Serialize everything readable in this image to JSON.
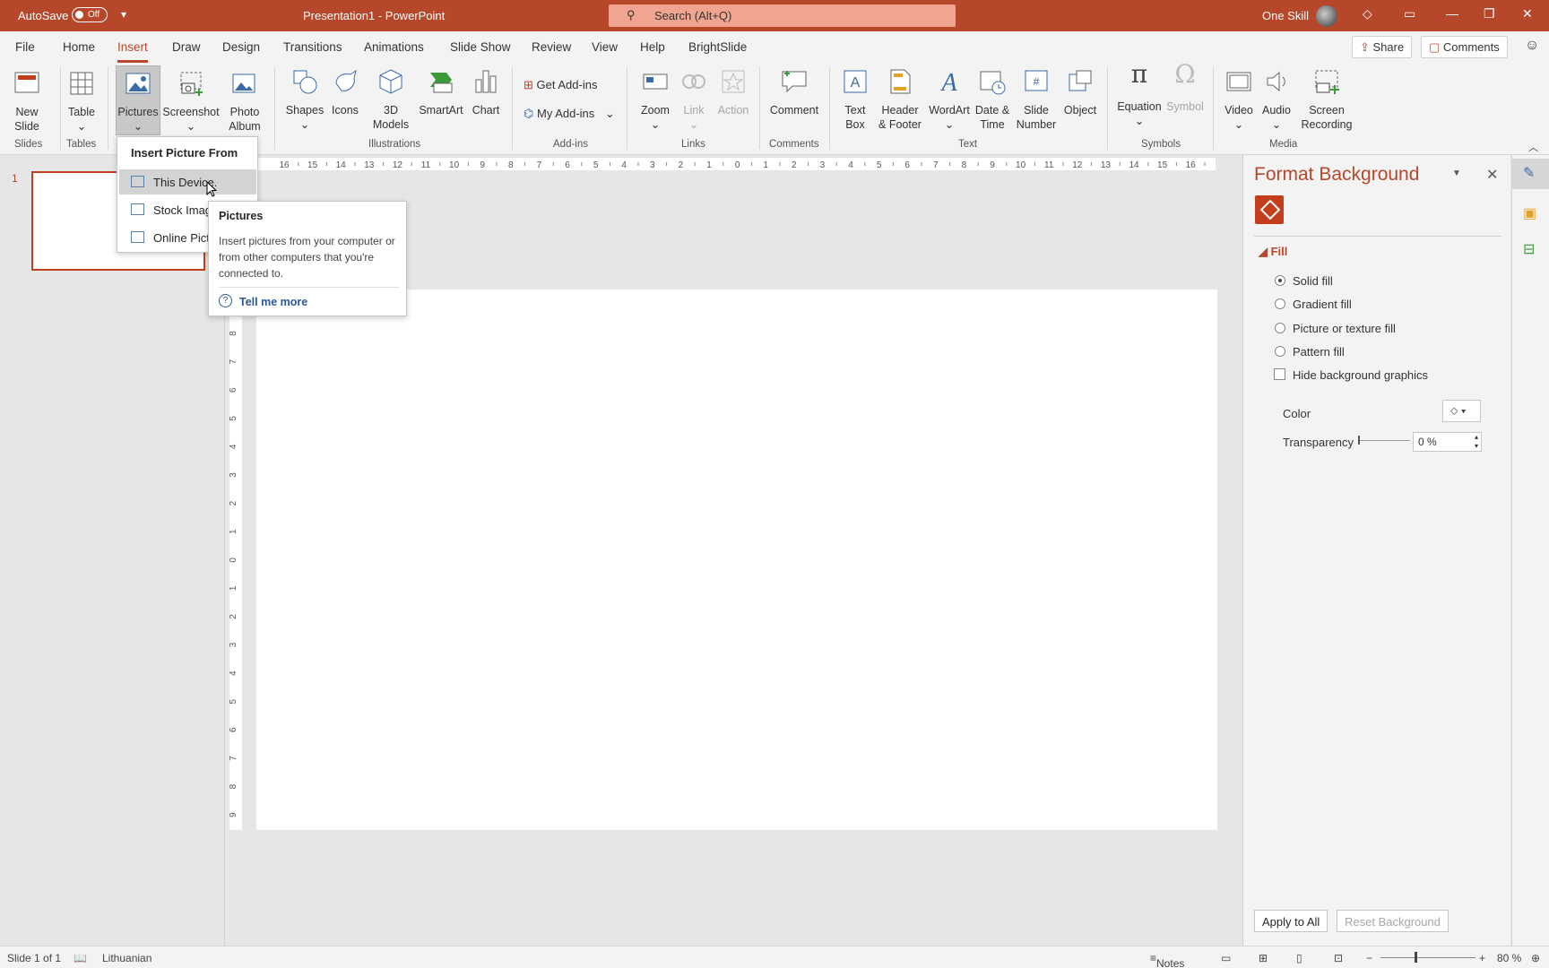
{
  "titlebar": {
    "autosave_label": "AutoSave",
    "autosave_state": "Off",
    "title": "Presentation1  -  PowerPoint",
    "search_placeholder": "Search (Alt+Q)",
    "user_name": "One Skill"
  },
  "tabs": [
    "File",
    "Home",
    "Insert",
    "Draw",
    "Design",
    "Transitions",
    "Animations",
    "Slide Show",
    "Review",
    "View",
    "Help",
    "BrightSlide"
  ],
  "active_tab": "Insert",
  "share_label": "Share",
  "comments_label": "Comments",
  "ribbon": {
    "slides": {
      "new_slide_1": "New",
      "new_slide_2": "Slide",
      "group": "Slides"
    },
    "tables": {
      "table": "Table",
      "group": "Tables"
    },
    "images": {
      "pictures": "Pictures",
      "screenshot": "Screenshot",
      "photo_album_1": "Photo",
      "photo_album_2": "Album"
    },
    "illustrations": {
      "shapes": "Shapes",
      "icons": "Icons",
      "models_1": "3D",
      "models_2": "Models",
      "smartart": "SmartArt",
      "chart": "Chart",
      "group": "Illustrations"
    },
    "addins": {
      "get": "Get Add-ins",
      "my": "My Add-ins",
      "group": "Add-ins"
    },
    "links": {
      "zoom": "Zoom",
      "link": "Link",
      "action": "Action",
      "group": "Links"
    },
    "comments": {
      "comment": "Comment",
      "group": "Comments"
    },
    "text": {
      "textbox_1": "Text",
      "textbox_2": "Box",
      "header_1": "Header",
      "header_2": "& Footer",
      "wordart": "WordArt",
      "date_1": "Date &",
      "date_2": "Time",
      "slideno_1": "Slide",
      "slideno_2": "Number",
      "object": "Object",
      "group": "Text"
    },
    "symbols": {
      "equation": "Equation",
      "symbol": "Symbol",
      "group": "Symbols"
    },
    "media": {
      "video": "Video",
      "audio": "Audio",
      "rec_1": "Screen",
      "rec_2": "Recording",
      "group": "Media"
    }
  },
  "dropdown": {
    "header": "Insert Picture From",
    "items": [
      "This Device...",
      "Stock Images...",
      "Online Pictures..."
    ]
  },
  "tooltip": {
    "title": "Pictures",
    "body": "Insert pictures from your computer or from other computers that you're connected to.",
    "link": "Tell me more"
  },
  "slide_panel": {
    "slide_number": "1"
  },
  "format_pane": {
    "title": "Format Background",
    "fill_header": "Fill",
    "options": [
      "Solid fill",
      "Gradient fill",
      "Picture or texture fill",
      "Pattern fill"
    ],
    "selected_option": "Solid fill",
    "hide_graphics": "Hide background graphics",
    "color_label": "Color",
    "transparency_label": "Transparency",
    "transparency_value": "0 %",
    "apply_all": "Apply to All",
    "reset": "Reset Background"
  },
  "ruler": {
    "horizontal": [
      "16",
      "15",
      "14",
      "13",
      "12",
      "11",
      "10",
      "9",
      "8",
      "7",
      "6",
      "5",
      "4",
      "3",
      "2",
      "1",
      "0",
      "1",
      "2",
      "3",
      "4",
      "5",
      "6",
      "7",
      "8",
      "9",
      "10",
      "11",
      "12",
      "13",
      "14",
      "15",
      "16"
    ],
    "vertical": [
      "8",
      "7",
      "6",
      "5",
      "4",
      "3",
      "2",
      "1",
      "0",
      "1",
      "2",
      "3",
      "4",
      "5",
      "6",
      "7",
      "8",
      "9"
    ]
  },
  "status": {
    "slide": "Slide 1 of 1",
    "language": "Lithuanian",
    "notes": "Notes",
    "zoom": "80 %"
  },
  "colors": {
    "accent": "#b7472a",
    "selection": "#c43e1c"
  }
}
